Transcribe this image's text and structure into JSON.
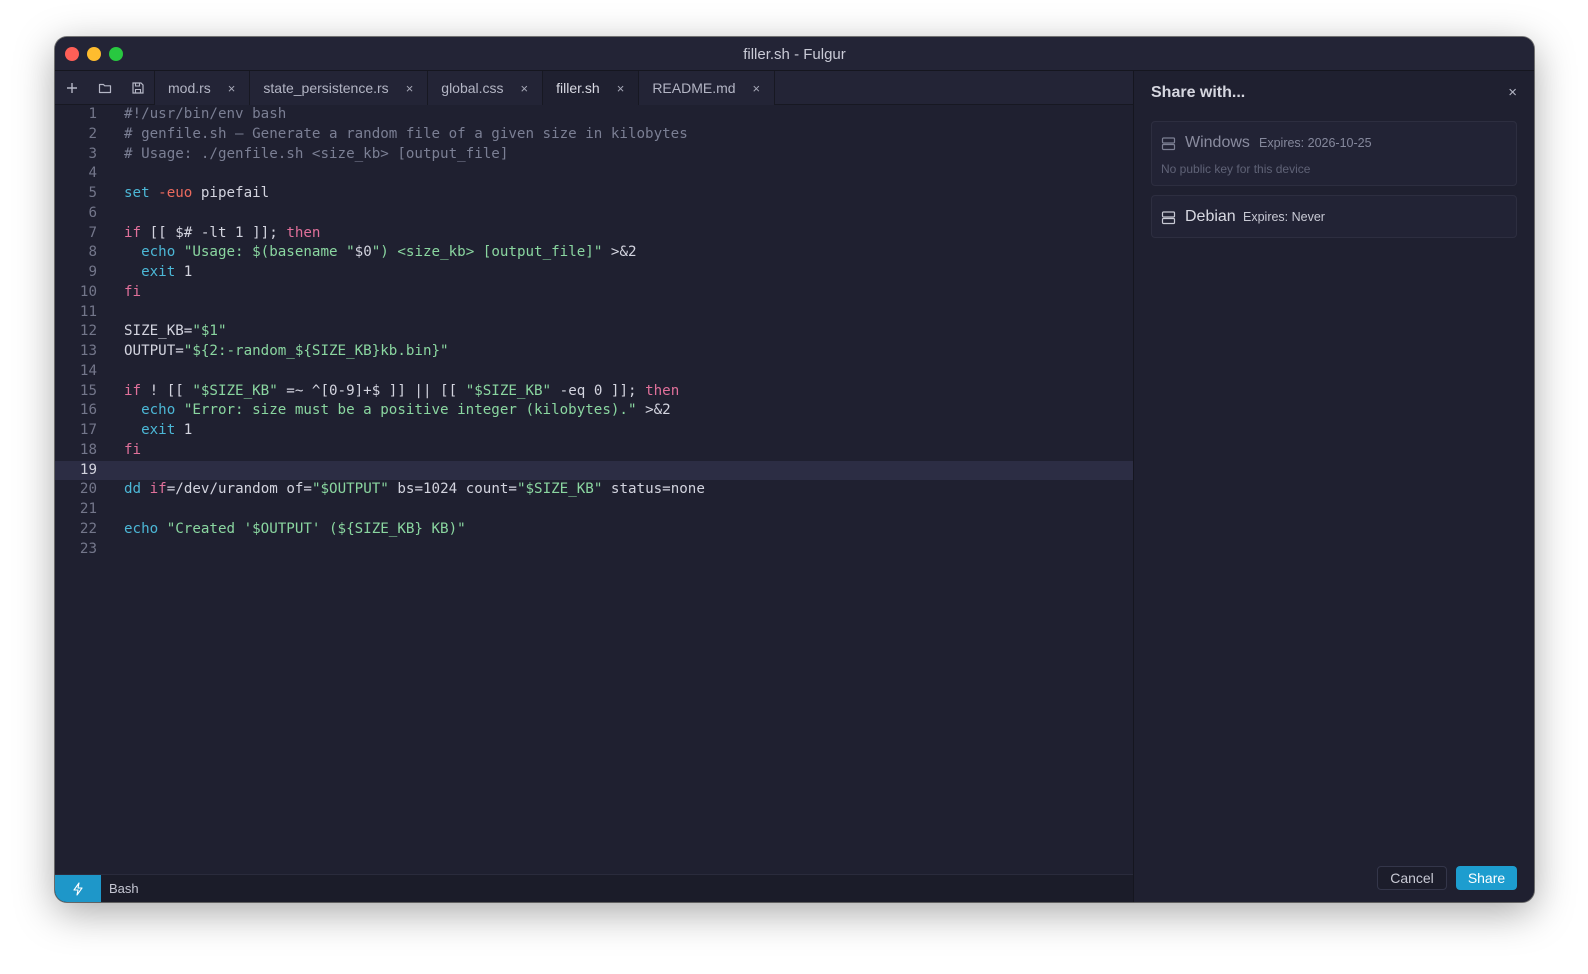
{
  "window": {
    "title": "filler.sh - Fulgur"
  },
  "toolbar": {
    "new_icon": "plus-icon",
    "open_icon": "folder-icon",
    "save_icon": "save-icon"
  },
  "tabs": [
    {
      "label": "mod.rs",
      "close": "×"
    },
    {
      "label": "state_persistence.rs",
      "close": "×"
    },
    {
      "label": "global.css",
      "close": "×"
    },
    {
      "label": "filler.sh",
      "close": "×",
      "active": true
    },
    {
      "label": "README.md",
      "close": "×"
    }
  ],
  "editor": {
    "current_line": 19,
    "lines": [
      {
        "n": "1",
        "text": "#!/usr/bin/env bash"
      },
      {
        "n": "2",
        "text": "# genfile.sh — Generate a random file of a given size in kilobytes"
      },
      {
        "n": "3",
        "text": "# Usage: ./genfile.sh <size_kb> [output_file]"
      },
      {
        "n": "4",
        "text": ""
      },
      {
        "n": "5",
        "text": "set -euo pipefail"
      },
      {
        "n": "6",
        "text": ""
      },
      {
        "n": "7",
        "text": "if [[ $# -lt 1 ]]; then"
      },
      {
        "n": "8",
        "text": "  echo \"Usage: $(basename \"$0\") <size_kb> [output_file]\" >&2"
      },
      {
        "n": "9",
        "text": "  exit 1"
      },
      {
        "n": "10",
        "text": "fi"
      },
      {
        "n": "11",
        "text": ""
      },
      {
        "n": "12",
        "text": "SIZE_KB=\"$1\""
      },
      {
        "n": "13",
        "text": "OUTPUT=\"${2:-random_${SIZE_KB}kb.bin}\""
      },
      {
        "n": "14",
        "text": ""
      },
      {
        "n": "15",
        "text": "if ! [[ \"$SIZE_KB\" =~ ^[0-9]+$ ]] || [[ \"$SIZE_KB\" -eq 0 ]]; then"
      },
      {
        "n": "16",
        "text": "  echo \"Error: size must be a positive integer (kilobytes).\" >&2"
      },
      {
        "n": "17",
        "text": "  exit 1"
      },
      {
        "n": "18",
        "text": "fi"
      },
      {
        "n": "19",
        "text": ""
      },
      {
        "n": "20",
        "text": "dd if=/dev/urandom of=\"$OUTPUT\" bs=1024 count=\"$SIZE_KB\" status=none"
      },
      {
        "n": "21",
        "text": ""
      },
      {
        "n": "22",
        "text": "echo \"Created '$OUTPUT' (${SIZE_KB} KB)\""
      },
      {
        "n": "23",
        "text": ""
      }
    ]
  },
  "statusbar": {
    "icon": "lightning-icon",
    "language": "Bash",
    "accent": "#1e97c9"
  },
  "share": {
    "title": "Share with...",
    "close": "×",
    "devices": [
      {
        "name": "Windows",
        "expires": "Expires: 2026-10-25",
        "note": "No public key for this device",
        "icon": "server-icon"
      },
      {
        "name": "Debian",
        "expires": "Expires: Never",
        "icon": "server-icon"
      }
    ],
    "cancel_label": "Cancel",
    "share_label": "Share",
    "share_color": "#1d9dcf"
  }
}
